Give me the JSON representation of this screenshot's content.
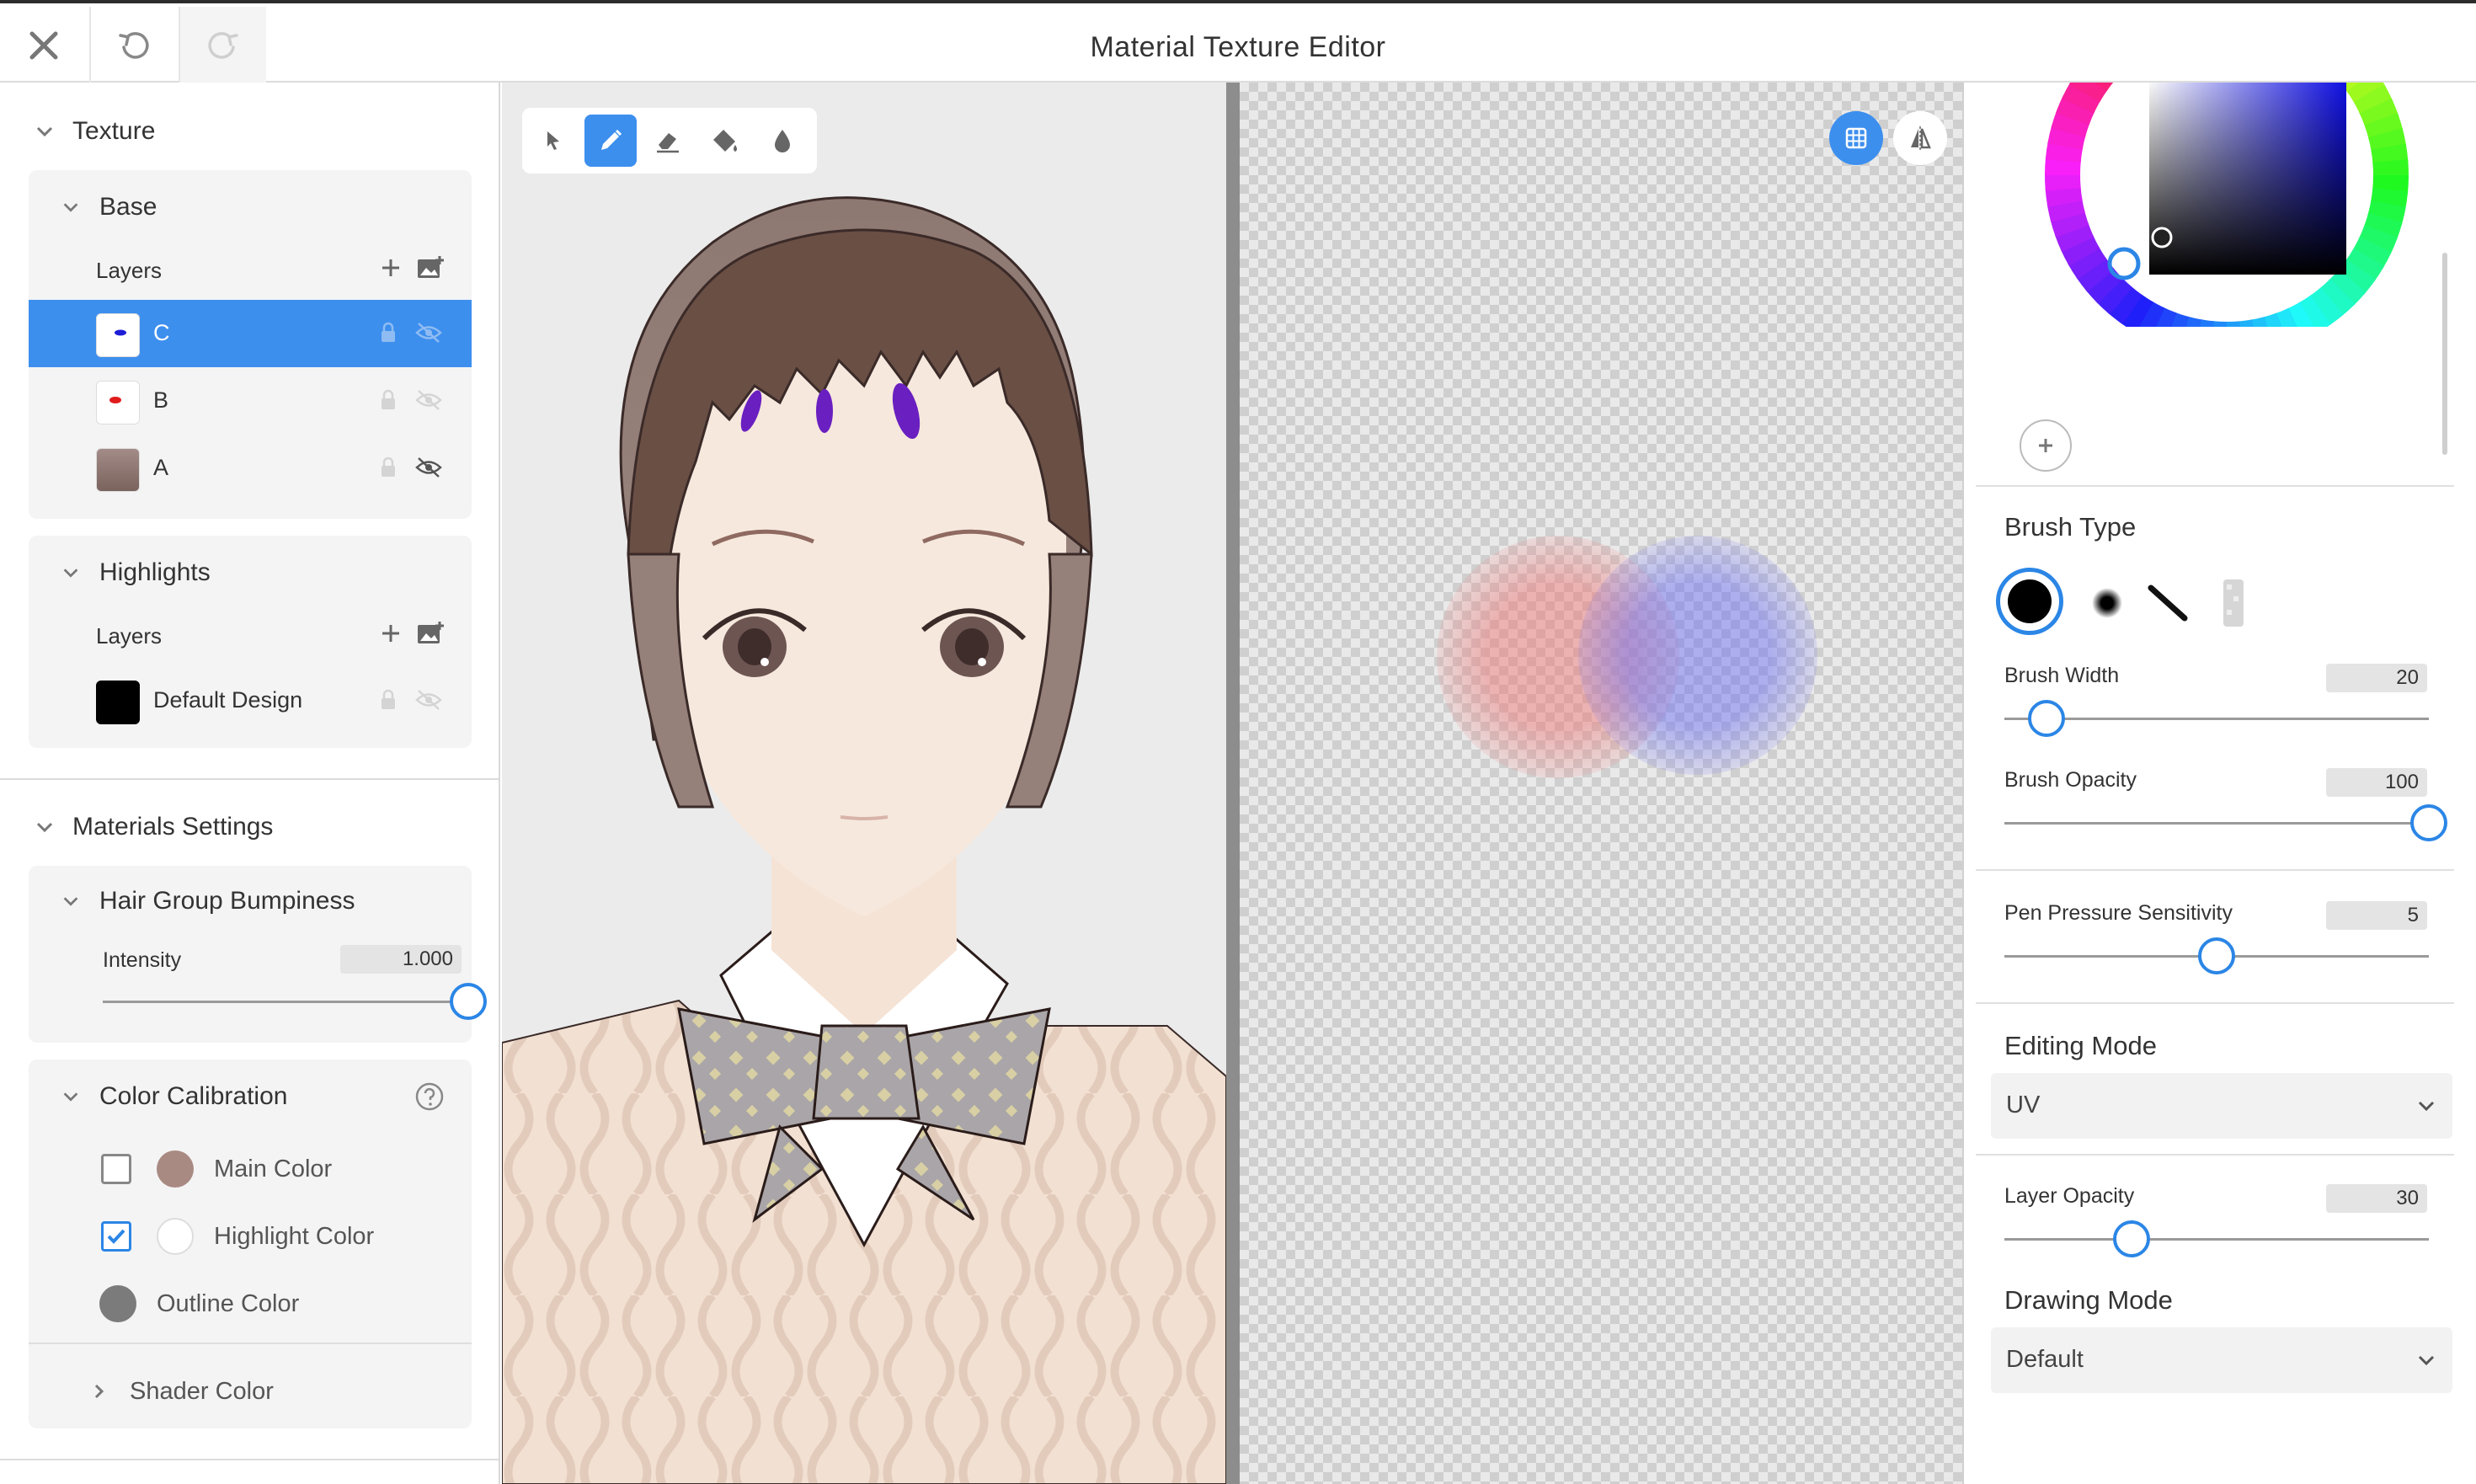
{
  "app": {
    "title": "Material Texture Editor",
    "close_icon": "close-icon",
    "undo_icon": "undo-icon",
    "redo_icon": "redo-icon"
  },
  "left_panel": {
    "texture": {
      "label": "Texture",
      "groups": [
        {
          "label": "Base",
          "layers_label": "Layers",
          "layers": [
            {
              "name": "C",
              "selected": true,
              "thumb_color": "#1d1dd8"
            },
            {
              "name": "B",
              "selected": false,
              "thumb_color": "#e01b1b"
            },
            {
              "name": "A",
              "selected": false,
              "thumb_color": "#8e7773"
            }
          ]
        },
        {
          "label": "Highlights",
          "layers_label": "Layers",
          "layers": [
            {
              "name": "Default Design",
              "selected": false,
              "thumb_color": "#000000"
            }
          ]
        }
      ]
    },
    "materials": {
      "label": "Materials Settings",
      "hair_group": {
        "label": "Hair Group Bumpiness",
        "intensity_label": "Intensity",
        "intensity_value": "1.000",
        "intensity_fraction": 1.0
      },
      "color_calibration": {
        "label": "Color Calibration",
        "items": [
          {
            "label": "Main Color",
            "checkbox": true,
            "checked": false,
            "color": "#a98a82"
          },
          {
            "label": "Highlight Color",
            "checkbox": true,
            "checked": true,
            "color": "#ffffff"
          },
          {
            "label": "Outline Color",
            "checkbox": false,
            "checked": false,
            "color": "#7b7b7b"
          }
        ],
        "shader_label": "Shader Color"
      }
    }
  },
  "toolbar": {
    "tools": [
      "select-arrow-icon",
      "pen-icon",
      "eraser-icon",
      "fill-bucket-icon",
      "dropper-icon"
    ],
    "active_tool": "pen-icon"
  },
  "uv_canvas": {
    "grid_icon": "grid-icon",
    "mirror_icon": "mirror-icon"
  },
  "right_panel": {
    "accent": "#2b86e6",
    "brush_type_label": "Brush Type",
    "brush_types": [
      "hard-round-brush-icon",
      "soft-brush-icon",
      "line-brush-icon",
      "texture-brush-icon"
    ],
    "brush_width_label": "Brush Width",
    "brush_width_value": "20",
    "brush_width_fraction": 0.1,
    "brush_opacity_label": "Brush Opacity",
    "brush_opacity_value": "100",
    "brush_opacity_fraction": 1.0,
    "pen_pressure_label": "Pen Pressure Sensitivity",
    "pen_pressure_value": "5",
    "pen_pressure_fraction": 0.5,
    "editing_mode_label": "Editing Mode",
    "editing_mode_value": "UV",
    "layer_opacity_label": "Layer Opacity",
    "layer_opacity_value": "30",
    "layer_opacity_fraction": 0.3,
    "drawing_mode_label": "Drawing Mode",
    "drawing_mode_value": "Default"
  }
}
